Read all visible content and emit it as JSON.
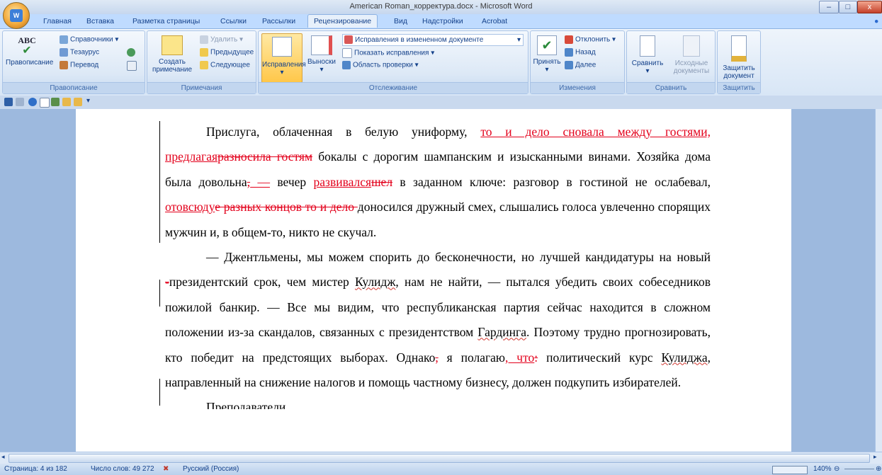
{
  "window": {
    "title": "American Roman_корректура.docx - Microsoft Word",
    "office_button_label": "W",
    "minimize": "–",
    "maximize": "□",
    "close": "x"
  },
  "tabs": [
    "Главная",
    "Вставка",
    "Разметка страницы",
    "Ссылки",
    "Рассылки",
    "Рецензирование",
    "Вид",
    "Надстройки",
    "Acrobat"
  ],
  "active_tab": "Рецензирование",
  "ribbon": {
    "proofing": {
      "label": "Правописание",
      "spelling": "Правописание",
      "spelling_icon_text": "ABC",
      "research": "Справочники",
      "thesaurus": "Тезаурус",
      "translate": "Перевод"
    },
    "comments": {
      "label": "Примечания",
      "new_comment_line1": "Создать",
      "new_comment_line2": "примечание",
      "delete": "Удалить",
      "previous": "Предыдущее",
      "next": "Следующее"
    },
    "tracking": {
      "label": "Отслеживание",
      "track_changes": "Исправления",
      "balloons": "Выноски",
      "display_mode": "Исправления в измененном документе",
      "show_markup": "Показать исправления",
      "reviewing_pane": "Область проверки"
    },
    "changes": {
      "label": "Изменения",
      "accept": "Принять",
      "reject": "Отклонить",
      "previous": "Назад",
      "next": "Далее"
    },
    "compare": {
      "label": "Сравнить",
      "compare": "Сравнить",
      "source_line1": "Исходные",
      "source_line2": "документы"
    },
    "protect": {
      "label": "Защитить",
      "protect_line1": "Защитить",
      "protect_line2": "документ"
    }
  },
  "document": {
    "p1": {
      "a": "Прислуга, облаченная в белую униформу, ",
      "ins1": "то и дело сновала между гостями, предлагая",
      "del1": "разносила гостям",
      "b": " бокалы с дорогим шампанским и изысканными винами. Хозяйка дома была довольна",
      "del2": ",",
      "ins2": " —",
      "c": " вечер ",
      "ins3": "развивался",
      "del3": "шел",
      "d": " в заданном ключе: разговор в гостиной не ослабевал, ",
      "ins4": "отовсюду",
      "del4": "е разных концов то и дело ",
      "e": "доносился дружный смех, слышались голоса увлеченно спорящих мужчин и, в общем-то, никто не скучал."
    },
    "p2": {
      "a": "— Джентльмены, мы можем спорить до бесконечности, но лучшей кандидатуры на новый",
      "ins1": " ",
      "del1": "-",
      "b": "президентский срок, чем мистер ",
      "name1": "Кулидж",
      "c": ", нам не найти, — пытался убедить своих собеседников пожилой банкир. — Все мы видим, что республиканская партия сейчас находится в сложном положении из-за скандалов, связанных с президентством ",
      "name2": "Гардинга",
      "d": ". Поэтому трудно прогнозировать, кто победит на предстоящих выборах. Однако",
      "del2": ",",
      "e": " я полагаю",
      "ins2": ", что",
      "del3": ":",
      "f": " политический курс ",
      "name3": "Кулиджа",
      "g": ", направленный на снижение налогов и помощь частному бизнесу, должен подкупить избирателей."
    },
    "p3_partial": "Преподаватели ..."
  },
  "status": {
    "page": "Страница: 4 из 182",
    "words": "Число слов: 49 272",
    "language": "Русский (Россия)",
    "zoom": "140%"
  },
  "colors": {
    "revision": "#e3001b",
    "ribbon_bg": "#d8e6f6",
    "workspace": "#9db9de"
  }
}
